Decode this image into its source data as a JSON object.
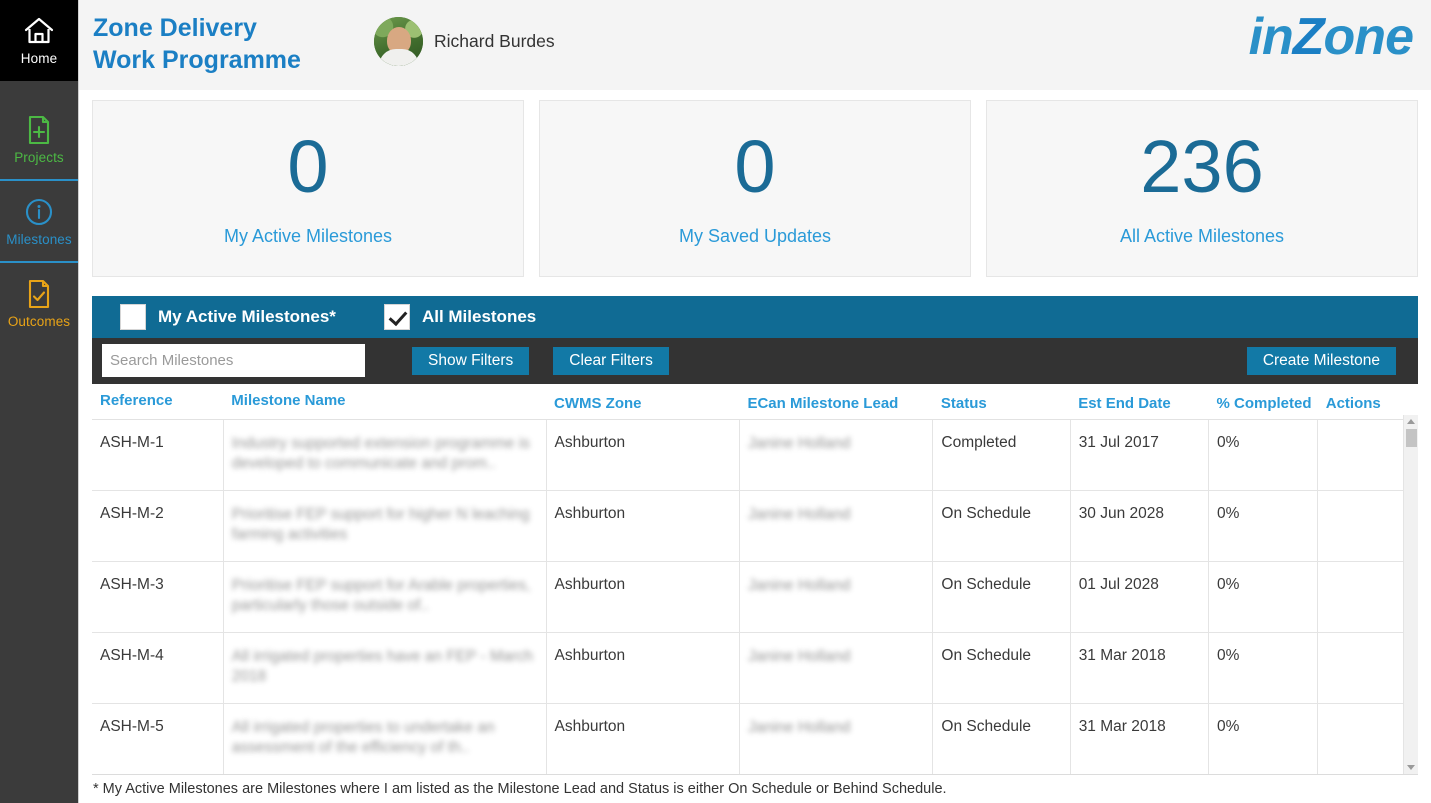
{
  "sidebar": {
    "items": [
      {
        "label": "Home",
        "icon": "home-icon"
      },
      {
        "label": "Projects",
        "icon": "document-plus-icon"
      },
      {
        "label": "Milestones",
        "icon": "info-circle-icon"
      },
      {
        "label": "Outcomes",
        "icon": "document-check-icon"
      }
    ]
  },
  "header": {
    "title_line1": "Zone Delivery",
    "title_line2": "Work Programme",
    "user_name": "Richard Burdes",
    "logo_part1": "in",
    "logo_part2": "Z",
    "logo_part3": "one"
  },
  "cards": [
    {
      "value": "0",
      "label": "My Active Milestones"
    },
    {
      "value": "0",
      "label": "My Saved Updates"
    },
    {
      "value": "236",
      "label": "All Active Milestones"
    }
  ],
  "filters": {
    "my_active_label": "My Active Milestones*",
    "my_active_checked": false,
    "all_milestones_label": "All Milestones",
    "all_milestones_checked": true,
    "search_placeholder": "Search Milestones",
    "search_value": "",
    "show_filters_label": "Show Filters",
    "clear_filters_label": "Clear Filters",
    "create_milestone_label": "Create Milestone"
  },
  "table": {
    "columns": [
      "Reference",
      "Milestone Name",
      "CWMS Zone",
      "ECan Milestone Lead",
      "Status",
      "Est End Date",
      "% Completed",
      "Actions"
    ],
    "rows": [
      {
        "reference": "ASH-M-1",
        "name": "Industry supported extension programme is developed to communicate and prom..",
        "zone": "Ashburton",
        "lead": "Janine Holland",
        "status": "Completed",
        "est_end_date": "31 Jul 2017",
        "percent_completed": "0%",
        "actions": ""
      },
      {
        "reference": "ASH-M-2",
        "name": "Prioritise FEP support for higher N leaching farming activities",
        "zone": "Ashburton",
        "lead": "Janine Holland",
        "status": "On Schedule",
        "est_end_date": "30 Jun 2028",
        "percent_completed": "0%",
        "actions": ""
      },
      {
        "reference": "ASH-M-3",
        "name": "Prioritise FEP support for Arable properties, particularly those outside of..",
        "zone": "Ashburton",
        "lead": "Janine Holland",
        "status": "On Schedule",
        "est_end_date": "01 Jul 2028",
        "percent_completed": "0%",
        "actions": ""
      },
      {
        "reference": "ASH-M-4",
        "name": "All irrigated properties have an FEP - March 2018",
        "zone": "Ashburton",
        "lead": "Janine Holland",
        "status": "On Schedule",
        "est_end_date": "31 Mar 2018",
        "percent_completed": "0%",
        "actions": ""
      },
      {
        "reference": "ASH-M-5",
        "name": "All irrigated properties to undertake an assessment of the efficiency of th..",
        "zone": "Ashburton",
        "lead": "Janine Holland",
        "status": "On Schedule",
        "est_end_date": "31 Mar 2018",
        "percent_completed": "0%",
        "actions": ""
      }
    ]
  },
  "footnote": "* My Active Milestones are Milestones where I am listed as the Milestone Lead and Status is either On Schedule or Behind Schedule.",
  "colors": {
    "brand_blue": "#2a90c8",
    "title_blue": "#1b7fc4",
    "filter_teal": "#106b94",
    "toolbar_dark": "#333333",
    "sidebar_dark": "#3b3b3b",
    "projects_green": "#4cb944",
    "outcomes_orange": "#e8a317",
    "card_value_blue": "#1b6b96"
  }
}
